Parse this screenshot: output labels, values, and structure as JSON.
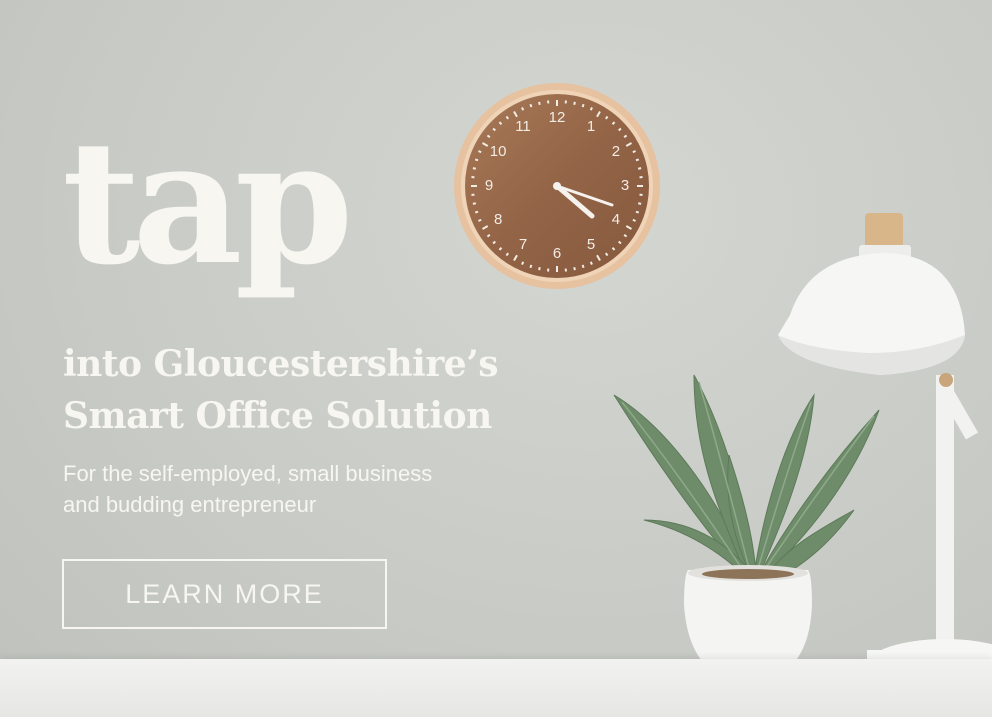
{
  "banner": {
    "brand": "tap",
    "headline_line1": "into Gloucestershire’s",
    "headline_line2": "Smart Office Solution",
    "subline_line1": "For the self-employed, small business",
    "subline_line2": "and budding entrepreneur",
    "cta_label": "LEARN MORE"
  },
  "clock": {
    "numerals": [
      "12",
      "1",
      "2",
      "3",
      "4",
      "5",
      "6",
      "7",
      "8",
      "9",
      "10",
      "11"
    ],
    "time": "3:20"
  },
  "icons": {
    "clock": "wall-clock-icon",
    "plant": "potted-plant-icon",
    "lamp": "desk-lamp-icon"
  },
  "colors": {
    "wall": "#c9cbc7",
    "text": "#f7f6f1",
    "clock_face": "#9a6b4c",
    "clock_rim": "#e8c4a4",
    "leaf": "#7f9a7a"
  }
}
